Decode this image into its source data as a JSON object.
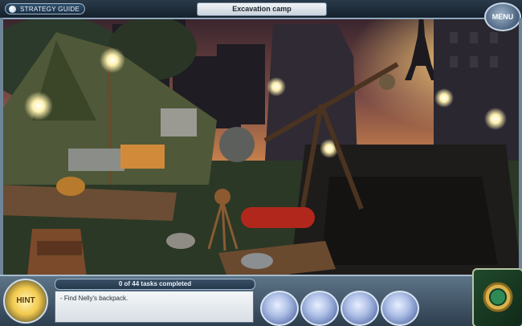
{
  "header": {
    "strategy_guide_label": "STRATEGY GUIDE",
    "location_title": "Excavation camp",
    "menu_label": "MENU"
  },
  "bottom": {
    "hint_label": "HINT",
    "tasks_progress": "0 of 44 tasks completed",
    "task_text": "- Find Nelly's backpack.",
    "inventory_slots": 4
  },
  "scene": {
    "landmark_icon": "eiffel-tower-icon",
    "colors": {
      "sky": "#3a2630",
      "glow": "#e59a54",
      "ground": "#2a3d27"
    }
  }
}
